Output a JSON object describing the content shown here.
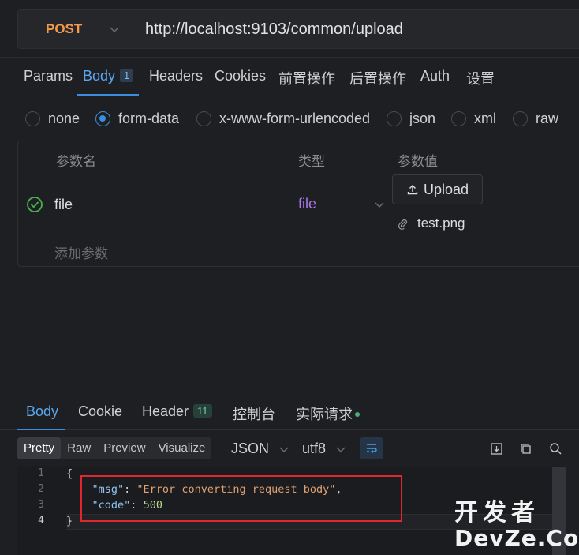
{
  "request": {
    "method": "POST",
    "url": "http://localhost:9103/common/upload"
  },
  "req_tabs": [
    {
      "label": "Params"
    },
    {
      "label": "Body",
      "badge": "1"
    },
    {
      "label": "Headers"
    },
    {
      "label": "Cookies"
    },
    {
      "label": "前置操作"
    },
    {
      "label": "后置操作"
    },
    {
      "label": "Auth"
    },
    {
      "label": "设置"
    }
  ],
  "body_types": [
    "none",
    "form-data",
    "x-www-form-urlencoded",
    "json",
    "xml",
    "raw"
  ],
  "body_type_selected": "form-data",
  "params_table": {
    "headers": [
      "参数名",
      "类型",
      "参数值"
    ],
    "row": {
      "name": "file",
      "type": "file",
      "upload_label": "Upload",
      "file_name": "test.png"
    },
    "add_placeholder": "添加参数"
  },
  "response": {
    "tabs": [
      {
        "label": "Body"
      },
      {
        "label": "Cookie"
      },
      {
        "label": "Header",
        "badge": "11"
      },
      {
        "label": "控制台"
      },
      {
        "label": "实际请求"
      }
    ],
    "view_modes": [
      "Pretty",
      "Raw",
      "Preview",
      "Visualize"
    ],
    "format": "JSON",
    "encoding": "utf8",
    "line_numbers": [
      "1",
      "2",
      "3",
      "4"
    ],
    "json": {
      "open": "{",
      "msg_key": "\"msg\"",
      "msg_value": "\"Error converting request body\"",
      "code_key": "\"code\"",
      "code_value": "500",
      "close": "}"
    }
  },
  "watermark": {
    "cn": "开发者",
    "en": "DevZe.CoM"
  },
  "colors": {
    "accent": "#3b8de0",
    "method": "#f39a4c",
    "type": "#a678e6",
    "highlight_box": "#e0262f"
  }
}
